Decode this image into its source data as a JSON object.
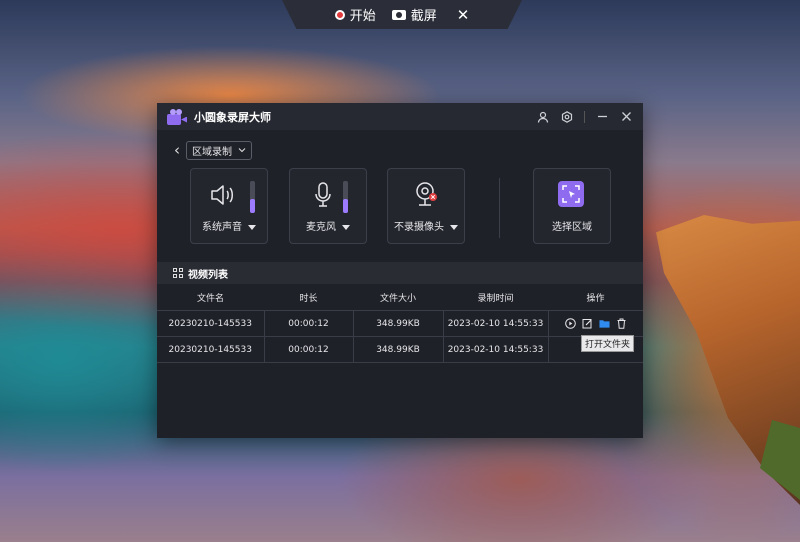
{
  "topbar": {
    "start_label": "开始",
    "screenshot_label": "截屏",
    "close_icon": "close-icon"
  },
  "app": {
    "title": "小圆象录屏大师",
    "accent": "#9c7bff"
  },
  "mode": {
    "selected": "区域录制"
  },
  "controls": {
    "system_audio": {
      "label": "系统声音",
      "level": 0.45
    },
    "microphone": {
      "label": "麦克风",
      "level": 0.45
    },
    "camera": {
      "label": "不录摄像头"
    },
    "region": {
      "label": "选择区域"
    }
  },
  "list": {
    "title": "视频列表",
    "columns": [
      "文件名",
      "时长",
      "文件大小",
      "录制时间",
      "操作"
    ],
    "rows": [
      {
        "name": "20230210-145533",
        "duration": "00:00:12",
        "size": "348.99KB",
        "time": "2023-02-10 14:55:33"
      },
      {
        "name": "20230210-145533",
        "duration": "00:00:12",
        "size": "348.99KB",
        "time": "2023-02-10 14:55:33"
      }
    ],
    "tooltip": "打开文件夹"
  }
}
